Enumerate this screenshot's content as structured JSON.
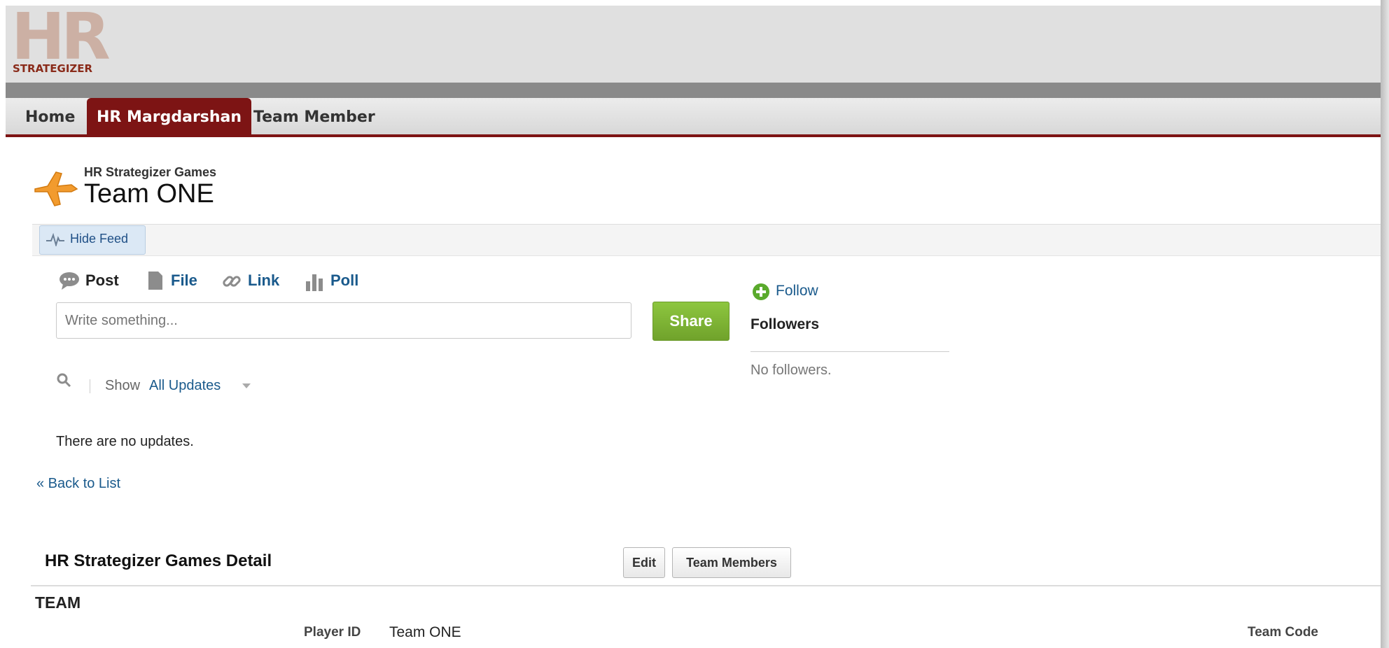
{
  "logo": {
    "text": "STRATEGIZER",
    "big_text": "HR",
    "icon": "hr-strategizer-logo"
  },
  "nav": {
    "tabs": [
      {
        "label": "Home",
        "active": false
      },
      {
        "label": "HR Margdarshan",
        "active": true
      },
      {
        "label": "Team Member",
        "active": false
      }
    ]
  },
  "record": {
    "object_type": "HR Strategizer Games",
    "title": "Team ONE",
    "icon": "airplane-icon"
  },
  "feed": {
    "hide_feed_label": "Hide Feed",
    "hide_feed_icon": "feed-pulse-icon",
    "publisher_tabs": [
      {
        "label": "Post",
        "icon": "chat-bubble-icon"
      },
      {
        "label": "File",
        "icon": "file-icon"
      },
      {
        "label": "Link",
        "icon": "link-icon"
      },
      {
        "label": "Poll",
        "icon": "poll-icon"
      }
    ],
    "input_placeholder": "Write something...",
    "share_label": "Share",
    "show_label": "Show",
    "show_value": "All Updates",
    "empty_message": "There are no updates."
  },
  "followers": {
    "follow_label": "Follow",
    "title": "Followers",
    "empty_message": "No followers."
  },
  "back_to_list": "« Back to List",
  "detail": {
    "title": "HR Strategizer Games Detail",
    "edit_label": "Edit",
    "team_members_label": "Team Members",
    "section_title": "TEAM",
    "player_id_label": "Player ID",
    "player_id_value": "Team ONE",
    "team_code_label": "Team Code"
  },
  "colors": {
    "tab_active": "#7d1414",
    "link": "#1a5a8c",
    "share_button": "#7cb342"
  }
}
